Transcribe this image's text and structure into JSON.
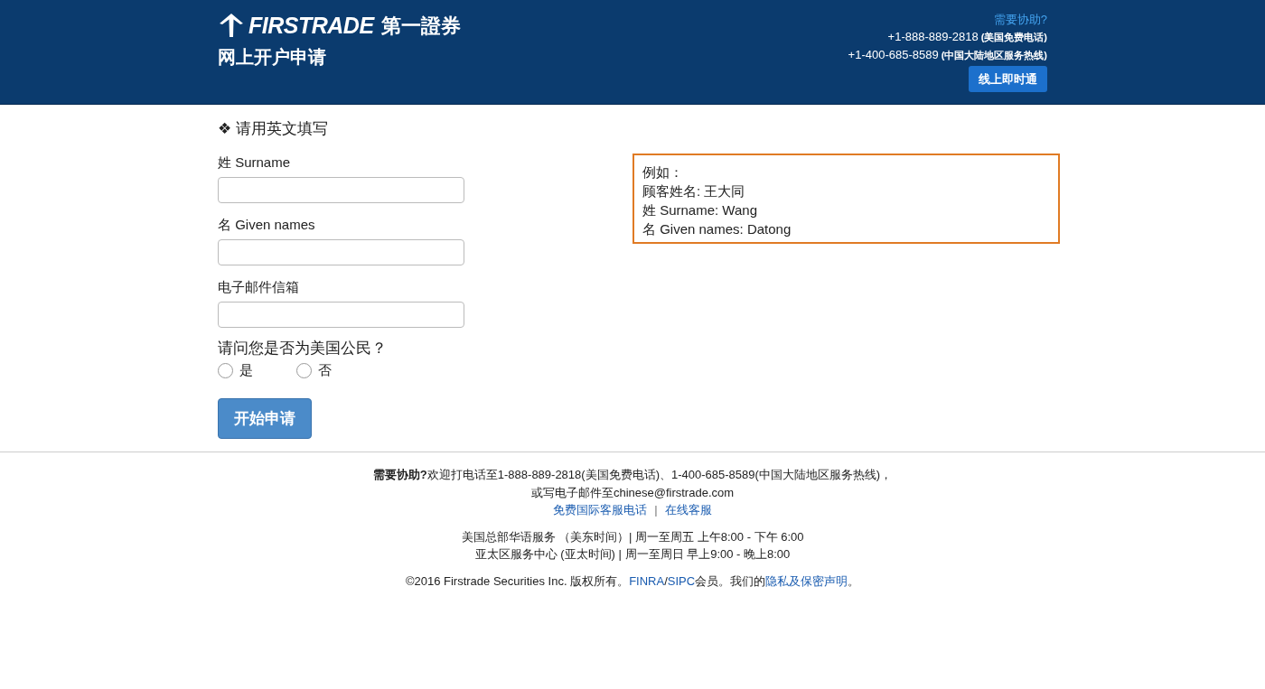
{
  "header": {
    "logo": {
      "wordmark": "FIRSTRADE",
      "chinese_name": "第一證券"
    },
    "title": "网上开户申请",
    "help_link": "需要协助?",
    "phones": [
      {
        "number": "+1-888-889-2818",
        "note": "(美国免费电话)"
      },
      {
        "number": "+1-400-685-8589",
        "note": "(中国大陆地区服务热线)"
      }
    ],
    "chat_button": "线上即时通"
  },
  "form": {
    "heading": "❖ 请用英文填写",
    "fields": [
      {
        "label": "姓 Surname"
      },
      {
        "label": "名 Given names"
      },
      {
        "label": "电子邮件信箱"
      }
    ],
    "question": {
      "text": "请问您是否为美国公民？",
      "options": [
        {
          "label": "是",
          "selected": false
        },
        {
          "label": "否",
          "selected": false
        }
      ]
    },
    "submit_button": "开始申请"
  },
  "example": {
    "lines": [
      "例如：",
      "顾客姓名: 王大同",
      "姓 Surname: Wang",
      "名 Given names: Datong"
    ]
  },
  "footer": {
    "help_lines": [
      "**需要协助?**欢迎打电话至1-888-889-2818(美国免费电话)、1-400-685-8589(中国大陆地区服务热线)，",
      "或写电子邮件至chinese@firstrade.com"
    ],
    "links": [
      "免费国际客服电话",
      "在线客服"
    ],
    "link_separator": "|",
    "hours": [
      "美国总部华语服务 （美东时间）| 周一至周五 上午8:00 - 下午 6:00",
      "亚太区服务中心 (亚太时间) | 周一至周日 早上9:00 - 晚上8:00"
    ],
    "copyright": [
      {
        "kind": "text",
        "text": "©2016 Firstrade Securities Inc. 版权所有。"
      },
      {
        "kind": "link",
        "text": "FINRA"
      },
      {
        "kind": "text",
        "text": "/"
      },
      {
        "kind": "link",
        "text": "SIPC"
      },
      {
        "kind": "text",
        "text": "会员。我们的"
      },
      {
        "kind": "link",
        "text": "隐私及保密声明"
      },
      {
        "kind": "text",
        "text": "。"
      }
    ]
  }
}
